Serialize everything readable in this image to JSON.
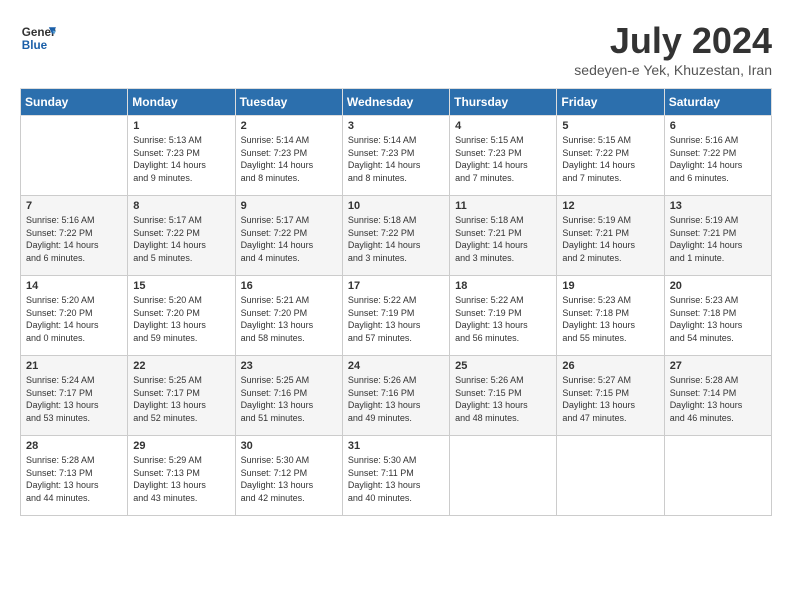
{
  "header": {
    "logo_line1": "General",
    "logo_line2": "Blue",
    "month_title": "July 2024",
    "subtitle": "sedeyen-e Yek, Khuzestan, Iran"
  },
  "weekdays": [
    "Sunday",
    "Monday",
    "Tuesday",
    "Wednesday",
    "Thursday",
    "Friday",
    "Saturday"
  ],
  "weeks": [
    [
      {
        "day": "",
        "info": ""
      },
      {
        "day": "1",
        "info": "Sunrise: 5:13 AM\nSunset: 7:23 PM\nDaylight: 14 hours\nand 9 minutes."
      },
      {
        "day": "2",
        "info": "Sunrise: 5:14 AM\nSunset: 7:23 PM\nDaylight: 14 hours\nand 8 minutes."
      },
      {
        "day": "3",
        "info": "Sunrise: 5:14 AM\nSunset: 7:23 PM\nDaylight: 14 hours\nand 8 minutes."
      },
      {
        "day": "4",
        "info": "Sunrise: 5:15 AM\nSunset: 7:23 PM\nDaylight: 14 hours\nand 7 minutes."
      },
      {
        "day": "5",
        "info": "Sunrise: 5:15 AM\nSunset: 7:22 PM\nDaylight: 14 hours\nand 7 minutes."
      },
      {
        "day": "6",
        "info": "Sunrise: 5:16 AM\nSunset: 7:22 PM\nDaylight: 14 hours\nand 6 minutes."
      }
    ],
    [
      {
        "day": "7",
        "info": "Sunrise: 5:16 AM\nSunset: 7:22 PM\nDaylight: 14 hours\nand 6 minutes."
      },
      {
        "day": "8",
        "info": "Sunrise: 5:17 AM\nSunset: 7:22 PM\nDaylight: 14 hours\nand 5 minutes."
      },
      {
        "day": "9",
        "info": "Sunrise: 5:17 AM\nSunset: 7:22 PM\nDaylight: 14 hours\nand 4 minutes."
      },
      {
        "day": "10",
        "info": "Sunrise: 5:18 AM\nSunset: 7:22 PM\nDaylight: 14 hours\nand 3 minutes."
      },
      {
        "day": "11",
        "info": "Sunrise: 5:18 AM\nSunset: 7:21 PM\nDaylight: 14 hours\nand 3 minutes."
      },
      {
        "day": "12",
        "info": "Sunrise: 5:19 AM\nSunset: 7:21 PM\nDaylight: 14 hours\nand 2 minutes."
      },
      {
        "day": "13",
        "info": "Sunrise: 5:19 AM\nSunset: 7:21 PM\nDaylight: 14 hours\nand 1 minute."
      }
    ],
    [
      {
        "day": "14",
        "info": "Sunrise: 5:20 AM\nSunset: 7:20 PM\nDaylight: 14 hours\nand 0 minutes."
      },
      {
        "day": "15",
        "info": "Sunrise: 5:20 AM\nSunset: 7:20 PM\nDaylight: 13 hours\nand 59 minutes."
      },
      {
        "day": "16",
        "info": "Sunrise: 5:21 AM\nSunset: 7:20 PM\nDaylight: 13 hours\nand 58 minutes."
      },
      {
        "day": "17",
        "info": "Sunrise: 5:22 AM\nSunset: 7:19 PM\nDaylight: 13 hours\nand 57 minutes."
      },
      {
        "day": "18",
        "info": "Sunrise: 5:22 AM\nSunset: 7:19 PM\nDaylight: 13 hours\nand 56 minutes."
      },
      {
        "day": "19",
        "info": "Sunrise: 5:23 AM\nSunset: 7:18 PM\nDaylight: 13 hours\nand 55 minutes."
      },
      {
        "day": "20",
        "info": "Sunrise: 5:23 AM\nSunset: 7:18 PM\nDaylight: 13 hours\nand 54 minutes."
      }
    ],
    [
      {
        "day": "21",
        "info": "Sunrise: 5:24 AM\nSunset: 7:17 PM\nDaylight: 13 hours\nand 53 minutes."
      },
      {
        "day": "22",
        "info": "Sunrise: 5:25 AM\nSunset: 7:17 PM\nDaylight: 13 hours\nand 52 minutes."
      },
      {
        "day": "23",
        "info": "Sunrise: 5:25 AM\nSunset: 7:16 PM\nDaylight: 13 hours\nand 51 minutes."
      },
      {
        "day": "24",
        "info": "Sunrise: 5:26 AM\nSunset: 7:16 PM\nDaylight: 13 hours\nand 49 minutes."
      },
      {
        "day": "25",
        "info": "Sunrise: 5:26 AM\nSunset: 7:15 PM\nDaylight: 13 hours\nand 48 minutes."
      },
      {
        "day": "26",
        "info": "Sunrise: 5:27 AM\nSunset: 7:15 PM\nDaylight: 13 hours\nand 47 minutes."
      },
      {
        "day": "27",
        "info": "Sunrise: 5:28 AM\nSunset: 7:14 PM\nDaylight: 13 hours\nand 46 minutes."
      }
    ],
    [
      {
        "day": "28",
        "info": "Sunrise: 5:28 AM\nSunset: 7:13 PM\nDaylight: 13 hours\nand 44 minutes."
      },
      {
        "day": "29",
        "info": "Sunrise: 5:29 AM\nSunset: 7:13 PM\nDaylight: 13 hours\nand 43 minutes."
      },
      {
        "day": "30",
        "info": "Sunrise: 5:30 AM\nSunset: 7:12 PM\nDaylight: 13 hours\nand 42 minutes."
      },
      {
        "day": "31",
        "info": "Sunrise: 5:30 AM\nSunset: 7:11 PM\nDaylight: 13 hours\nand 40 minutes."
      },
      {
        "day": "",
        "info": ""
      },
      {
        "day": "",
        "info": ""
      },
      {
        "day": "",
        "info": ""
      }
    ]
  ]
}
